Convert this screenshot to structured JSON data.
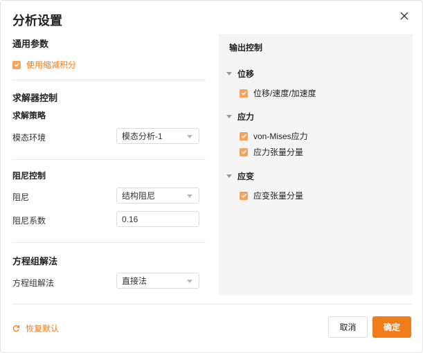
{
  "dialog": {
    "title": "分析设置",
    "close_icon": "close-icon"
  },
  "general": {
    "title": "通用参数",
    "reduced_integration_label": "使用缩减积分",
    "reduced_integration_checked": true
  },
  "solver": {
    "title": "求解器控制",
    "strategy_title": "求解策略",
    "modal_env_label": "模态环境",
    "modal_env_value": "模态分析-1"
  },
  "damping": {
    "title": "阻尼控制",
    "damping_label": "阻尼",
    "damping_value": "结构阻尼",
    "coef_label": "阻尼系数",
    "coef_value": "0.16"
  },
  "equation": {
    "title": "方程组解法",
    "method_label": "方程组解法",
    "method_value": "直接法"
  },
  "output": {
    "title": "输出控制",
    "groups": [
      {
        "label": "位移",
        "items": [
          {
            "label": "位移/速度/加速度",
            "checked": true
          }
        ]
      },
      {
        "label": "应力",
        "items": [
          {
            "label": "von-Mises应力",
            "checked": true
          },
          {
            "label": "应力张量分量",
            "checked": true
          }
        ]
      },
      {
        "label": "应变",
        "items": [
          {
            "label": "应变张量分量",
            "checked": true
          }
        ]
      }
    ]
  },
  "footer": {
    "reset_label": "恢复默认",
    "cancel_label": "取消",
    "ok_label": "确定"
  },
  "colors": {
    "accent": "#f07c1a",
    "checkbox": "#f5a460",
    "panel_bg": "#f5f5f5"
  }
}
